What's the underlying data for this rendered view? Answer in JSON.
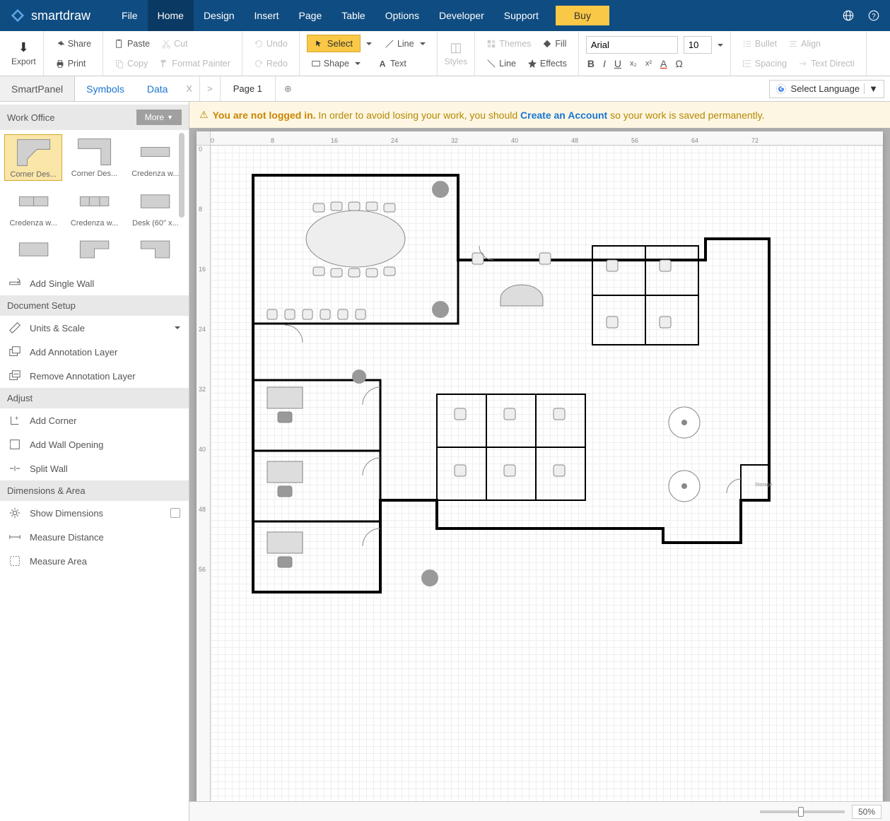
{
  "app": {
    "name": "smartdraw"
  },
  "menu": {
    "items": [
      "File",
      "Home",
      "Design",
      "Insert",
      "Page",
      "Table",
      "Options",
      "Developer",
      "Support"
    ],
    "active": "Home",
    "buy": "Buy"
  },
  "ribbon": {
    "export": "Export",
    "share": "Share",
    "print": "Print",
    "paste": "Paste",
    "cut": "Cut",
    "copy": "Copy",
    "format_painter": "Format Painter",
    "undo": "Undo",
    "redo": "Redo",
    "select": "Select",
    "line": "Line",
    "shape": "Shape",
    "text": "Text",
    "styles": "Styles",
    "themes": "Themes",
    "fill": "Fill",
    "line2": "Line",
    "effects": "Effects",
    "font": "Arial",
    "font_size": "10",
    "bullet": "Bullet",
    "align": "Align",
    "spacing": "Spacing",
    "text_direction": "Text Directi"
  },
  "tabs": {
    "smart_panel": "SmartPanel",
    "symbols": "Symbols",
    "data": "Data",
    "page": "Page 1",
    "lang": "Select Language"
  },
  "notif": {
    "warn_bold": "You are not logged in.",
    "warn_text": " In order to avoid losing your work, you should ",
    "link": "Create an Account",
    "tail": " so your work is saved permanently."
  },
  "sidebar": {
    "lib_name": "Work Office",
    "more": "More",
    "symbols": [
      "Corner Des...",
      "Corner Des...",
      "Credenza w...",
      "Credenza w...",
      "Credenza w...",
      "Desk (60\" x..."
    ],
    "add_wall": "Add Single Wall",
    "doc_setup": "Document Setup",
    "units_scale": "Units & Scale",
    "add_annot": "Add Annotation Layer",
    "remove_annot": "Remove Annotation Layer",
    "adjust": "Adjust",
    "add_corner": "Add Corner",
    "add_opening": "Add Wall Opening",
    "split_wall": "Split Wall",
    "dim_area": "Dimensions & Area",
    "show_dim": "Show Dimensions",
    "measure_dist": "Measure Distance",
    "measure_area": "Measure Area"
  },
  "ruler": {
    "h_ticks": [
      "0",
      "8",
      "16",
      "24",
      "32",
      "40",
      "48",
      "56",
      "64",
      "72"
    ],
    "v_ticks": [
      "0",
      "8",
      "16",
      "24",
      "32",
      "40",
      "48",
      "56"
    ]
  },
  "status": {
    "zoom": "50%"
  },
  "floorplan": {
    "storage_label": "Storage"
  }
}
